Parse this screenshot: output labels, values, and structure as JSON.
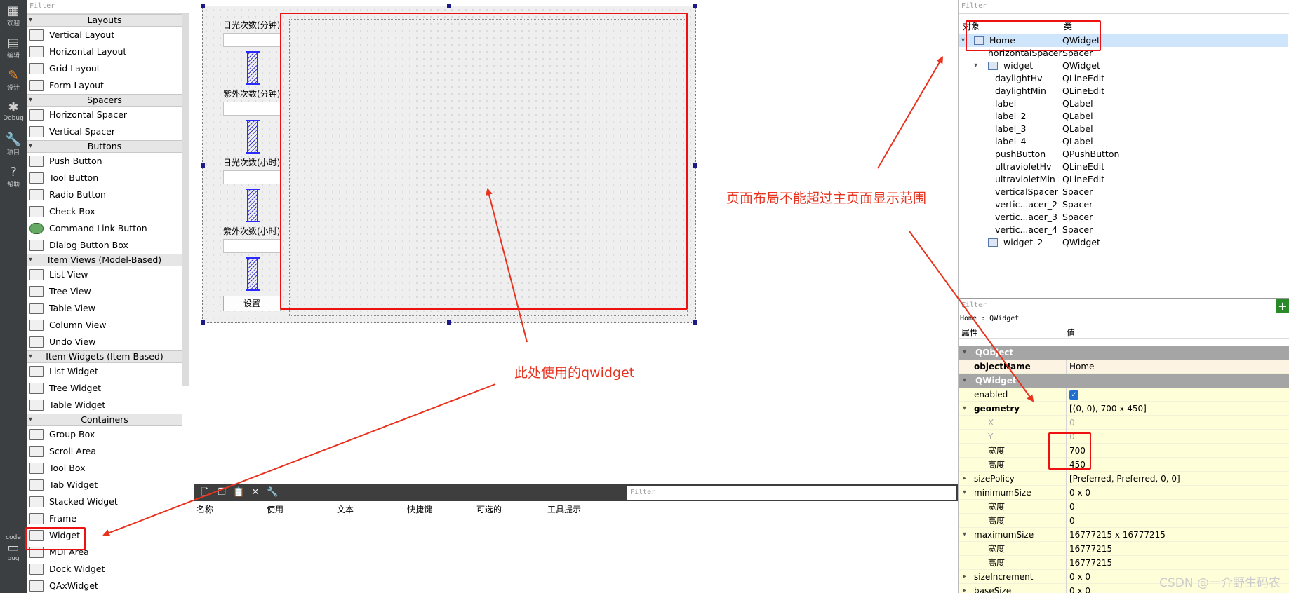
{
  "modebar": {
    "items": [
      {
        "label": "欢迎",
        "icon": "grid-icon"
      },
      {
        "label": "编辑",
        "icon": "edit-icon"
      },
      {
        "label": "设计",
        "icon": "design-icon"
      },
      {
        "label": "Debug",
        "icon": "bug-icon"
      },
      {
        "label": "项目",
        "icon": "wrench-icon"
      },
      {
        "label": "帮助",
        "icon": "help-icon"
      }
    ],
    "kit_label": "code",
    "kit_mode": "bug"
  },
  "widgetbox": {
    "filter_placeholder": "Filter",
    "categories": [
      {
        "name": "Layouts",
        "items": [
          "Vertical Layout",
          "Horizontal Layout",
          "Grid Layout",
          "Form Layout"
        ]
      },
      {
        "name": "Spacers",
        "items": [
          "Horizontal Spacer",
          "Vertical Spacer"
        ]
      },
      {
        "name": "Buttons",
        "items": [
          "Push Button",
          "Tool Button",
          "Radio Button",
          "Check Box",
          "Command Link Button",
          "Dialog Button Box"
        ]
      },
      {
        "name": "Item Views (Model-Based)",
        "items": [
          "List View",
          "Tree View",
          "Table View",
          "Column View",
          "Undo View"
        ]
      },
      {
        "name": "Item Widgets (Item-Based)",
        "items": [
          "List Widget",
          "Tree Widget",
          "Table Widget"
        ]
      },
      {
        "name": "Containers",
        "items": [
          "Group Box",
          "Scroll Area",
          "Tool Box",
          "Tab Widget",
          "Stacked Widget",
          "Frame",
          "Widget",
          "MDI Area",
          "Dock Widget",
          "QAxWidget"
        ]
      }
    ]
  },
  "form": {
    "labels": [
      "日光次数(分钟)",
      "紫外次数(分钟)",
      "日光次数(小时)",
      "紫外次数(小时)"
    ],
    "button": "设置"
  },
  "actions": {
    "filter_placeholder": "Filter",
    "headers": [
      "名称",
      "使用",
      "文本",
      "快捷键",
      "可选的",
      "工具提示"
    ]
  },
  "object_inspector": {
    "filter_placeholder": "Filter",
    "headers": [
      "对象",
      "类"
    ],
    "rows": [
      {
        "object": "Home",
        "class": "QWidget"
      },
      {
        "object": "horizontalSpacer",
        "class": "Spacer"
      },
      {
        "object": "widget",
        "class": "QWidget"
      },
      {
        "object": "daylightHv",
        "class": "QLineEdit"
      },
      {
        "object": "daylightMin",
        "class": "QLineEdit"
      },
      {
        "object": "label",
        "class": "QLabel"
      },
      {
        "object": "label_2",
        "class": "QLabel"
      },
      {
        "object": "label_3",
        "class": "QLabel"
      },
      {
        "object": "label_4",
        "class": "QLabel"
      },
      {
        "object": "pushButton",
        "class": "QPushButton"
      },
      {
        "object": "ultravioletHv",
        "class": "QLineEdit"
      },
      {
        "object": "ultravioletMin",
        "class": "QLineEdit"
      },
      {
        "object": "verticalSpacer",
        "class": "Spacer"
      },
      {
        "object": "vertic...acer_2",
        "class": "Spacer"
      },
      {
        "object": "vertic...acer_3",
        "class": "Spacer"
      },
      {
        "object": "vertic...acer_4",
        "class": "Spacer"
      },
      {
        "object": "widget_2",
        "class": "QWidget"
      }
    ]
  },
  "property_editor": {
    "filter_placeholder": "Filter",
    "title": "Home : QWidget",
    "headers": [
      "属性",
      "值"
    ],
    "groups": {
      "qobject": "QObject",
      "qwidget": "QWidget"
    },
    "object_name": {
      "name": "objectName",
      "value": "Home"
    },
    "enabled": {
      "name": "enabled",
      "checked": true
    },
    "geometry": {
      "name": "geometry",
      "value": "[(0, 0), 700 x 450]",
      "x_label": "X",
      "x": "0",
      "y_label": "Y",
      "y": "0",
      "width_label": "宽度",
      "width": "700",
      "height_label": "高度",
      "height": "450"
    },
    "size_policy": {
      "name": "sizePolicy",
      "value": "[Preferred, Preferred, 0, 0]"
    },
    "minimum_size": {
      "name": "minimumSize",
      "value": "0 x 0",
      "width_label": "宽度",
      "width": "0",
      "height_label": "高度",
      "height": "0"
    },
    "maximum_size": {
      "name": "maximumSize",
      "value": "16777215 x 16777215",
      "width_label": "宽度",
      "width": "16777215",
      "height_label": "高度",
      "height": "16777215"
    },
    "size_increment": {
      "name": "sizeIncrement",
      "value": "0 x 0"
    },
    "base_size": {
      "name": "baseSize",
      "value": "0 x 0"
    }
  },
  "annotations": {
    "layout_note": "页面布局不能超过主页面显示范围",
    "widget_note": "此处使用的qwidget",
    "color": "#e8321e"
  },
  "watermark": "CSDN @一介野生码农"
}
